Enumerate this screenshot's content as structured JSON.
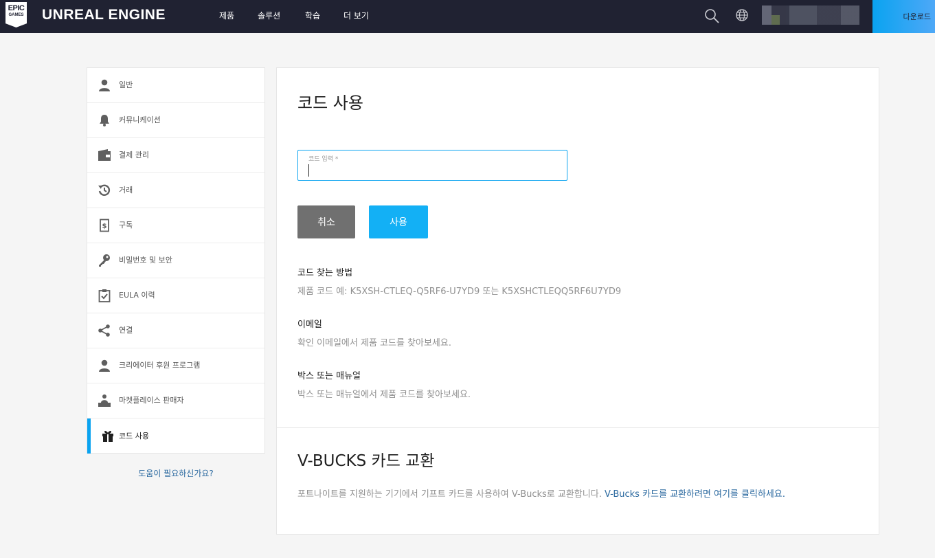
{
  "header": {
    "logo_line1": "EPIC",
    "logo_line2": "GAMES",
    "brand": "UNREAL ENGINE",
    "nav": [
      "제품",
      "솔루션",
      "학습",
      "더 보기"
    ],
    "download_label": "다운로드"
  },
  "sidebar": {
    "items": [
      {
        "label": "일반",
        "icon": "user-icon"
      },
      {
        "label": "커뮤니케이션",
        "icon": "bell-icon"
      },
      {
        "label": "결제 관리",
        "icon": "wallet-icon"
      },
      {
        "label": "거래",
        "icon": "history-icon"
      },
      {
        "label": "구독",
        "icon": "receipt-icon"
      },
      {
        "label": "비밀번호 및 보안",
        "icon": "key-icon"
      },
      {
        "label": "EULA 이력",
        "icon": "clipboard-check-icon"
      },
      {
        "label": "연결",
        "icon": "share-icon"
      },
      {
        "label": "크리에이터 후원 프로그램",
        "icon": "user-icon"
      },
      {
        "label": "마켓플레이스 판매자",
        "icon": "seller-icon"
      },
      {
        "label": "코드 사용",
        "icon": "gift-icon",
        "active": true
      }
    ],
    "help_link": "도움이 필요하신가요?"
  },
  "main": {
    "title": "코드 사용",
    "code_input": {
      "label": "코드 입력 *",
      "value": ""
    },
    "cancel_label": "취소",
    "use_label": "사용",
    "sections": [
      {
        "heading": "코드 찾는 방법",
        "text": "제품 코드 예: K5XSH-CTLEQ-Q5RF6-U7YD9 또는 K5XSHCTLEQQ5RF6U7YD9"
      },
      {
        "heading": "이메일",
        "text": "확인 이메일에서 제품 코드를 찾아보세요."
      },
      {
        "heading": "박스 또는 매뉴얼",
        "text": "박스 또는 매뉴얼에서 제품 코드를 찾아보세요."
      }
    ],
    "vbucks": {
      "title": "V-BUCKS 카드 교환",
      "text": "포트나이트를 지원하는 기기에서 기프트 카드를 사용하여 V-Bucks로 교환합니다.",
      "link": "V-Bucks 카드를 교환하려면 여기를 클릭하세요."
    }
  },
  "colors": {
    "nav_bg": "#202232",
    "accent": "#0aa3f0",
    "use_button": "#13b0f5",
    "cancel_button": "#707070",
    "link": "#2c6aa0"
  }
}
